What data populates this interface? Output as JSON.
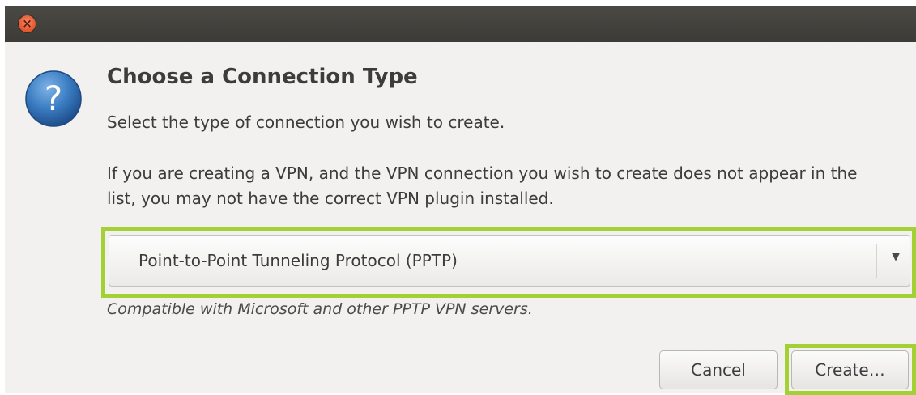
{
  "window": {
    "close_glyph": "×"
  },
  "dialog": {
    "icon": "question-icon",
    "title": "Choose a Connection Type",
    "subtitle": "Select the type of connection you wish to create.",
    "info": "If you are creating a VPN, and the VPN connection you wish to create does not appear in the list, you may not have the correct VPN plugin installed.",
    "connection_type": {
      "selected": "Point-to-Point Tunneling Protocol (PPTP)",
      "arrow": "▼"
    },
    "description": "Compatible with Microsoft and other PPTP VPN servers.",
    "buttons": {
      "cancel": "Cancel",
      "create": "Create…"
    }
  },
  "colors": {
    "titlebar": "#3c3b37",
    "close_button": "#e2532a",
    "highlight": "#a3d133",
    "question_icon": "#2b67a8"
  }
}
